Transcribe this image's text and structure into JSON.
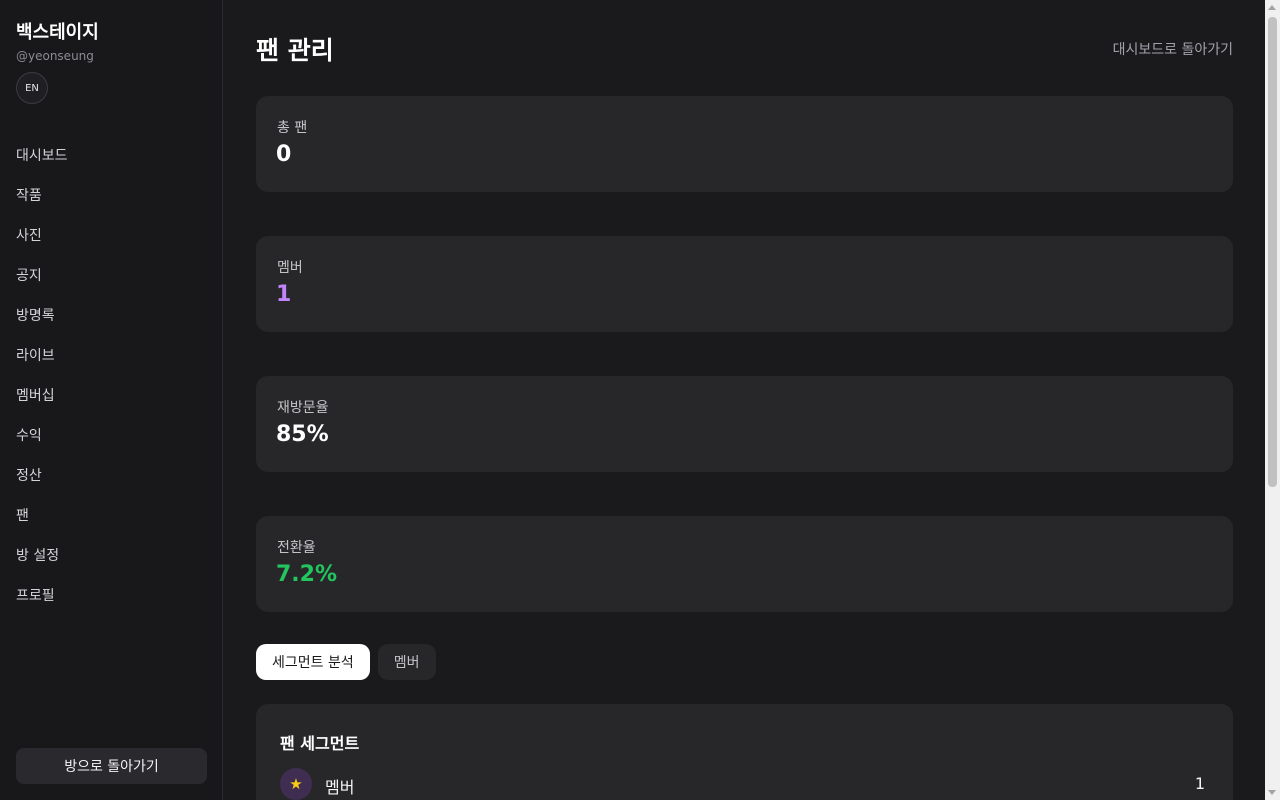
{
  "sidebar": {
    "brand_title": "백스테이지",
    "handle": "@yeonseung",
    "lang_button": "EN",
    "nav": [
      {
        "label": "대시보드",
        "name": "sidebar-item-dashboard"
      },
      {
        "label": "작품",
        "name": "sidebar-item-works"
      },
      {
        "label": "사진",
        "name": "sidebar-item-photos"
      },
      {
        "label": "공지",
        "name": "sidebar-item-notices"
      },
      {
        "label": "방명록",
        "name": "sidebar-item-guestbook"
      },
      {
        "label": "라이브",
        "name": "sidebar-item-live"
      },
      {
        "label": "멤버십",
        "name": "sidebar-item-membership"
      },
      {
        "label": "수익",
        "name": "sidebar-item-revenue"
      },
      {
        "label": "정산",
        "name": "sidebar-item-settlement"
      },
      {
        "label": "팬",
        "name": "sidebar-item-fans"
      },
      {
        "label": "방 설정",
        "name": "sidebar-item-room-settings"
      },
      {
        "label": "프로필",
        "name": "sidebar-item-profile"
      }
    ],
    "back_to_room": "방으로 돌아가기"
  },
  "header": {
    "title": "팬 관리",
    "back_to_dashboard": "대시보드로 돌아가기"
  },
  "stats": [
    {
      "label": "총 팬",
      "value": "0",
      "color": "#ffffff"
    },
    {
      "label": "멤버",
      "value": "1",
      "color": "#c084fc"
    },
    {
      "label": "재방문율",
      "value": "85%",
      "color": "#ffffff"
    },
    {
      "label": "전환율",
      "value": "7.2%",
      "color": "#22c55e"
    }
  ],
  "tabs": [
    {
      "label": "세그먼트 분석",
      "active": true
    },
    {
      "label": "멤버",
      "active": false
    }
  ],
  "segments": {
    "title": "팬 세그먼트",
    "rows": [
      {
        "icon": "star-icon",
        "label": "멤버",
        "count": "1"
      }
    ]
  }
}
